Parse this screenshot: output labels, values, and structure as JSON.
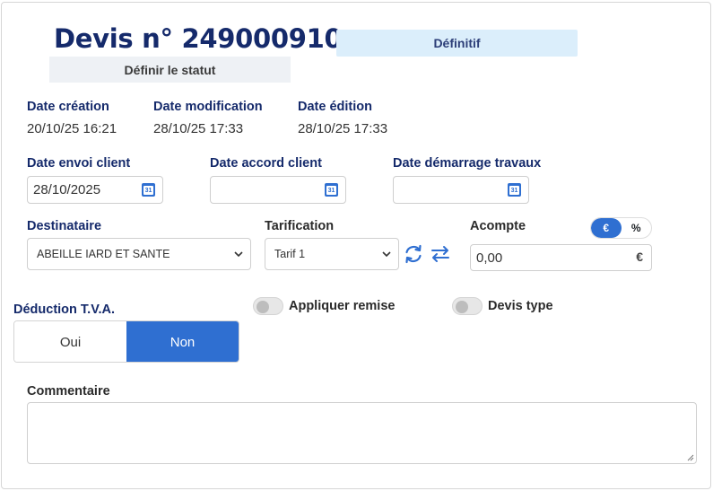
{
  "header": {
    "title": "Devis n° 249000910",
    "status": "Définitif",
    "set_status_label": "Définir le statut"
  },
  "dates": {
    "creation": {
      "label": "Date création",
      "value": "20/10/25 16:21"
    },
    "modification": {
      "label": "Date modification",
      "value": "28/10/25 17:33"
    },
    "edition": {
      "label": "Date édition",
      "value": "28/10/25 17:33"
    }
  },
  "date_fields": {
    "envoi_client": {
      "label": "Date envoi client",
      "value": "28/10/2025"
    },
    "accord_client": {
      "label": "Date accord client",
      "value": ""
    },
    "demarrage_travaux": {
      "label": "Date démarrage travaux",
      "value": ""
    },
    "calendar_icon_text": "31"
  },
  "destinataire": {
    "label": "Destinataire",
    "selected": "ABEILLE IARD ET SANTE"
  },
  "tarification": {
    "label": "Tarification",
    "selected": "Tarif 1"
  },
  "acompte": {
    "label": "Acompte",
    "value": "0,00",
    "unit_symbol": "€",
    "modes": [
      "€",
      "%"
    ],
    "active_mode": "€"
  },
  "tva": {
    "label": "Déduction T.V.A.",
    "options": [
      "Oui",
      "Non"
    ],
    "selected": "Non"
  },
  "toggles": {
    "appliquer_remise": {
      "label": "Appliquer remise",
      "on": false
    },
    "devis_type": {
      "label": "Devis type",
      "on": false
    }
  },
  "commentaire": {
    "label": "Commentaire",
    "value": ""
  },
  "colors": {
    "accent": "#2f6fd1",
    "heading": "#152a6b",
    "status_bg": "#dbeefb"
  },
  "icons": [
    "calendar-icon",
    "refresh-icon",
    "swap-arrows-icon",
    "chevron-down-icon",
    "euro-icon"
  ]
}
